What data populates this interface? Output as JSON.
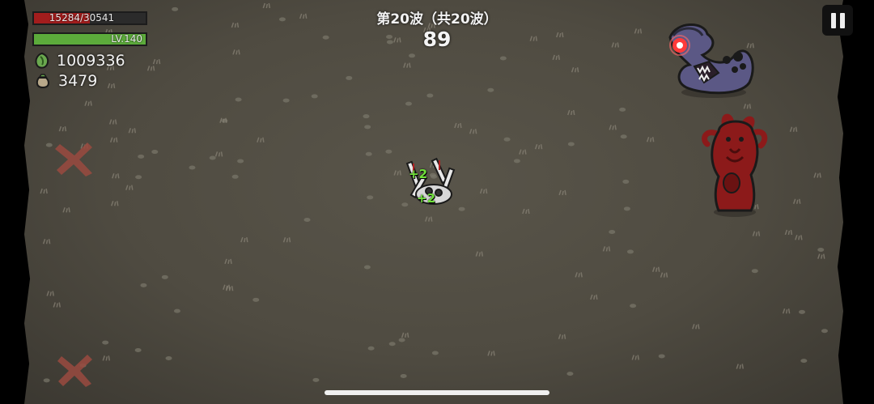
{
  "hud": {
    "hp": {
      "current": 15284,
      "max": 30541,
      "text": "15284/30541"
    },
    "level": {
      "text": "LV.140",
      "progress": 1.0
    },
    "materials": {
      "icon": "green-gem-icon",
      "value": "1009336"
    },
    "bag": {
      "icon": "money-bag-icon",
      "value": "3479"
    },
    "wave_label": "第20波（共20波）",
    "timer": "89",
    "pause_icon": "pause-icon"
  },
  "floating_numbers": [
    {
      "text": "+2"
    },
    {
      "text": "+2"
    }
  ],
  "colors": {
    "hp_fill": "#a31d1d",
    "xp_fill": "#5cab3b",
    "ground": "#524e44",
    "heal_text": "#6fe03a",
    "purple_enemy": "#5b5885",
    "red_enemy": "#8c1a1a",
    "marker_x": "#9a4a40"
  },
  "entities": [
    {
      "type": "player",
      "name": "player-character"
    },
    {
      "type": "enemy",
      "name": "purple-serpent-enemy"
    },
    {
      "type": "enemy",
      "name": "red-tentacle-demon-enemy"
    },
    {
      "type": "marker",
      "name": "spawn-marker-x"
    },
    {
      "type": "marker",
      "name": "spawn-marker-x"
    }
  ]
}
